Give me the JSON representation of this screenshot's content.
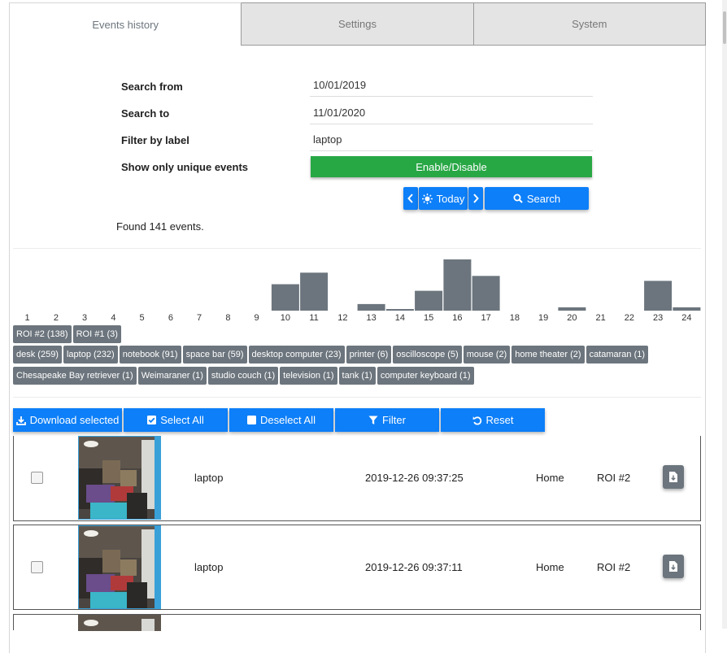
{
  "tabs": [
    {
      "label": "Events history",
      "active": true
    },
    {
      "label": "Settings",
      "active": false
    },
    {
      "label": "System",
      "active": false
    }
  ],
  "form": {
    "search_from_label": "Search from",
    "search_from_value": "10/01/2019",
    "search_to_label": "Search to",
    "search_to_value": "11/01/2020",
    "filter_label": "Filter by label",
    "filter_value": "laptop",
    "unique_label": "Show only unique events",
    "toggle_label": "Enable/Disable"
  },
  "nav": {
    "today_label": "Today",
    "search_label": "Search"
  },
  "found_text": "Found 141 events.",
  "histogram": {
    "hours": [
      "1",
      "2",
      "3",
      "4",
      "5",
      "6",
      "7",
      "8",
      "9",
      "10",
      "11",
      "12",
      "13",
      "14",
      "15",
      "16",
      "17",
      "18",
      "19",
      "20",
      "21",
      "22",
      "23",
      "24"
    ],
    "counts": [
      0,
      0,
      0,
      0,
      0,
      0,
      0,
      0,
      0,
      16,
      23,
      0,
      4,
      1,
      12,
      31,
      21,
      0,
      0,
      2,
      0,
      0,
      18,
      2
    ],
    "bar_color": "#6c757d"
  },
  "roi_badges": [
    "ROI #2 (138)",
    "ROI #1 (3)"
  ],
  "label_badges_row1": [
    "desk (259)",
    "laptop (232)",
    "notebook (91)",
    "space bar (59)",
    "desktop computer (23)",
    "printer (6)",
    "oscilloscope (5)",
    "mouse (2)",
    "home theater (2)",
    "catamaran (1)"
  ],
  "label_badges_row2": [
    "Chesapeake Bay retriever (1)",
    "Weimaraner (1)",
    "studio couch (1)",
    "television (1)",
    "tank (1)",
    "computer keyboard (1)"
  ],
  "actions": {
    "download_label": "Download selected",
    "select_all_label": "Select All",
    "deselect_all_label": "Deselect All",
    "filter_label": "Filter",
    "reset_label": "Reset"
  },
  "events": [
    {
      "label": "laptop",
      "timestamp": "2019-12-26 09:37:25",
      "camera": "Home",
      "roi": "ROI #2"
    },
    {
      "label": "laptop",
      "timestamp": "2019-12-26 09:37:11",
      "camera": "Home",
      "roi": "ROI #2"
    }
  ],
  "colors": {
    "primary": "#0d7ff8",
    "success": "#28a745",
    "secondary": "#6c757d"
  }
}
